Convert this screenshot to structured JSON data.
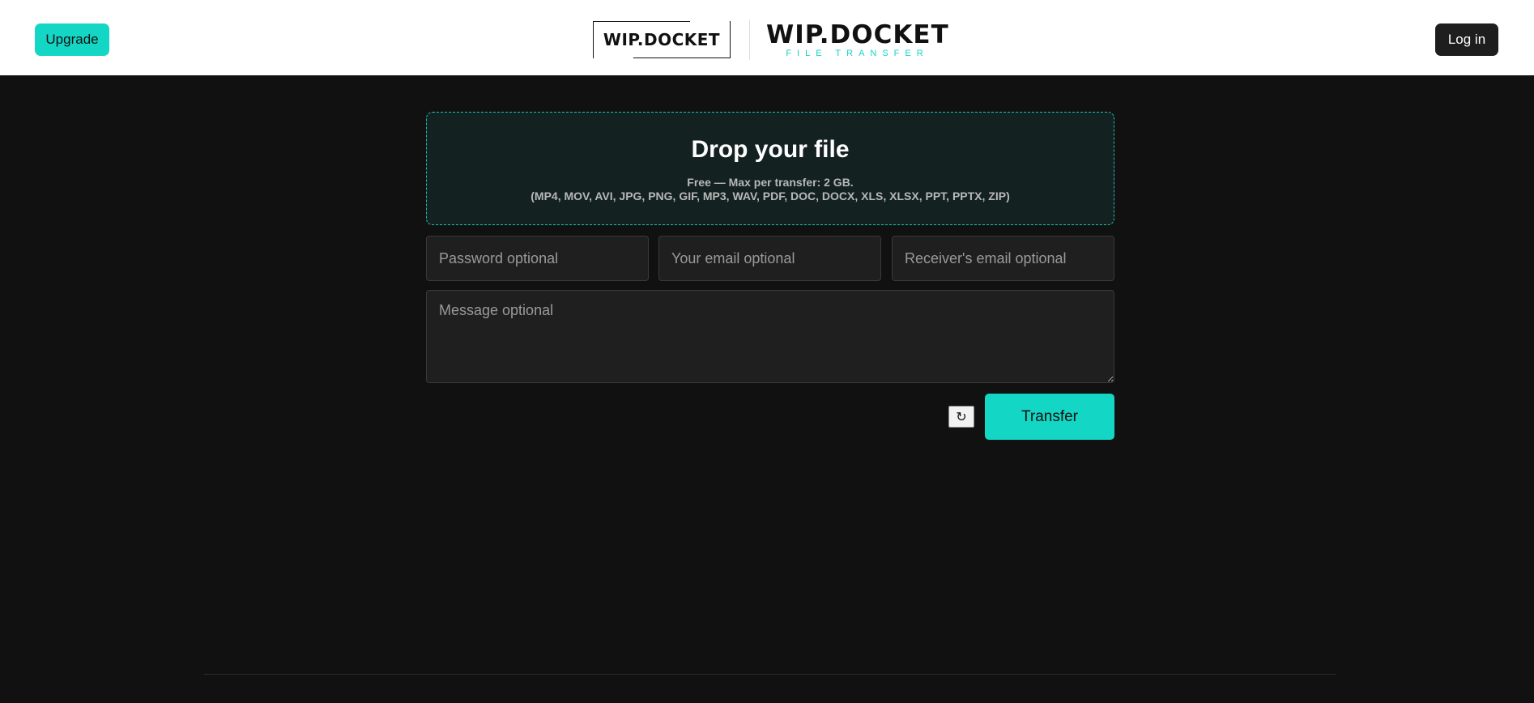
{
  "header": {
    "upgrade_label": "Upgrade",
    "login_label": "Log in",
    "logo_box_text": "WIP.DOCKET",
    "logo_title": "WIP.DOCKET",
    "logo_subtitle": "FILE TRANSFER"
  },
  "dropzone": {
    "title": "Drop your file",
    "limit_text": "Free — Max per transfer: 2 GB.",
    "formats_text": "(MP4, MOV, AVI, JPG, PNG, GIF, MP3, WAV, PDF, DOC, DOCX, XLS, XLSX, PPT, PPTX, ZIP)"
  },
  "form": {
    "password_placeholder": "Password optional",
    "password_value": "",
    "sender_email_placeholder": "Your email optional",
    "sender_email_value": "",
    "receiver_email_placeholder": "Receiver's email optional",
    "receiver_email_value": "",
    "message_placeholder": "Message optional",
    "message_value": "",
    "refresh_glyph": "↻",
    "transfer_label": "Transfer"
  },
  "colors": {
    "accent": "#14d6c4",
    "background": "#111111",
    "header_background": "#ffffff",
    "field_background": "#1f1f1f",
    "dark_button": "#1e1e1e"
  },
  "icons": {
    "refresh": "refresh-icon"
  }
}
